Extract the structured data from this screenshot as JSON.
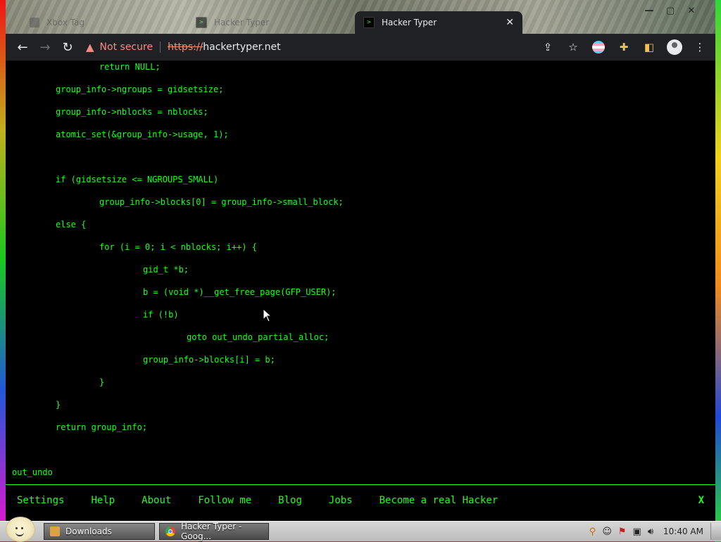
{
  "browser": {
    "tabs": [
      {
        "label": "Xbox Tag",
        "active": false
      },
      {
        "label": "Hacker Typer",
        "active": false
      },
      {
        "label": "Hacker Typer",
        "active": true
      }
    ],
    "address": {
      "warning_label": "Not secure",
      "scheme": "https://",
      "host": "hackertyper.net"
    }
  },
  "code_lines": [
    {
      "indent": 2,
      "text": "return NULL;"
    },
    {
      "indent": 1,
      "text": "group_info->ngroups = gidsetsize;"
    },
    {
      "indent": 1,
      "text": "group_info->nblocks = nblocks;"
    },
    {
      "indent": 1,
      "text": "atomic_set(&group_info->usage, 1);"
    },
    {
      "indent": 0,
      "text": ""
    },
    {
      "indent": 1,
      "text": "if (gidsetsize <= NGROUPS_SMALL)"
    },
    {
      "indent": 2,
      "text": "group_info->blocks[0] = group_info->small_block;"
    },
    {
      "indent": 1,
      "text": "else {"
    },
    {
      "indent": 2,
      "text": "for (i = 0; i < nblocks; i++) {"
    },
    {
      "indent": 3,
      "text": "gid_t *b;"
    },
    {
      "indent": 3,
      "text": "b = (void *)__get_free_page(GFP_USER);"
    },
    {
      "indent": 3,
      "text": "if (!b)"
    },
    {
      "indent": 4,
      "text": "goto out_undo_partial_alloc;"
    },
    {
      "indent": 3,
      "text": "group_info->blocks[i] = b;"
    },
    {
      "indent": 2,
      "text": "}"
    },
    {
      "indent": 1,
      "text": "}"
    },
    {
      "indent": 1,
      "text": "return group_info;"
    },
    {
      "indent": 0,
      "text": ""
    },
    {
      "indent": 0,
      "text": "out_undo"
    }
  ],
  "nav": {
    "items": [
      "Settings",
      "Help",
      "About",
      "Follow me",
      "Blog",
      "Jobs",
      "Become a real Hacker"
    ],
    "close_label": "X"
  },
  "taskbar": {
    "tasks": [
      "Downloads",
      "Hacker Typer - Goog..."
    ],
    "clock": "10:40 AM"
  },
  "colors": {
    "terminal_green": "#1dff1d",
    "chrome_dark": "#202124",
    "warning_red": "#f28b82"
  }
}
